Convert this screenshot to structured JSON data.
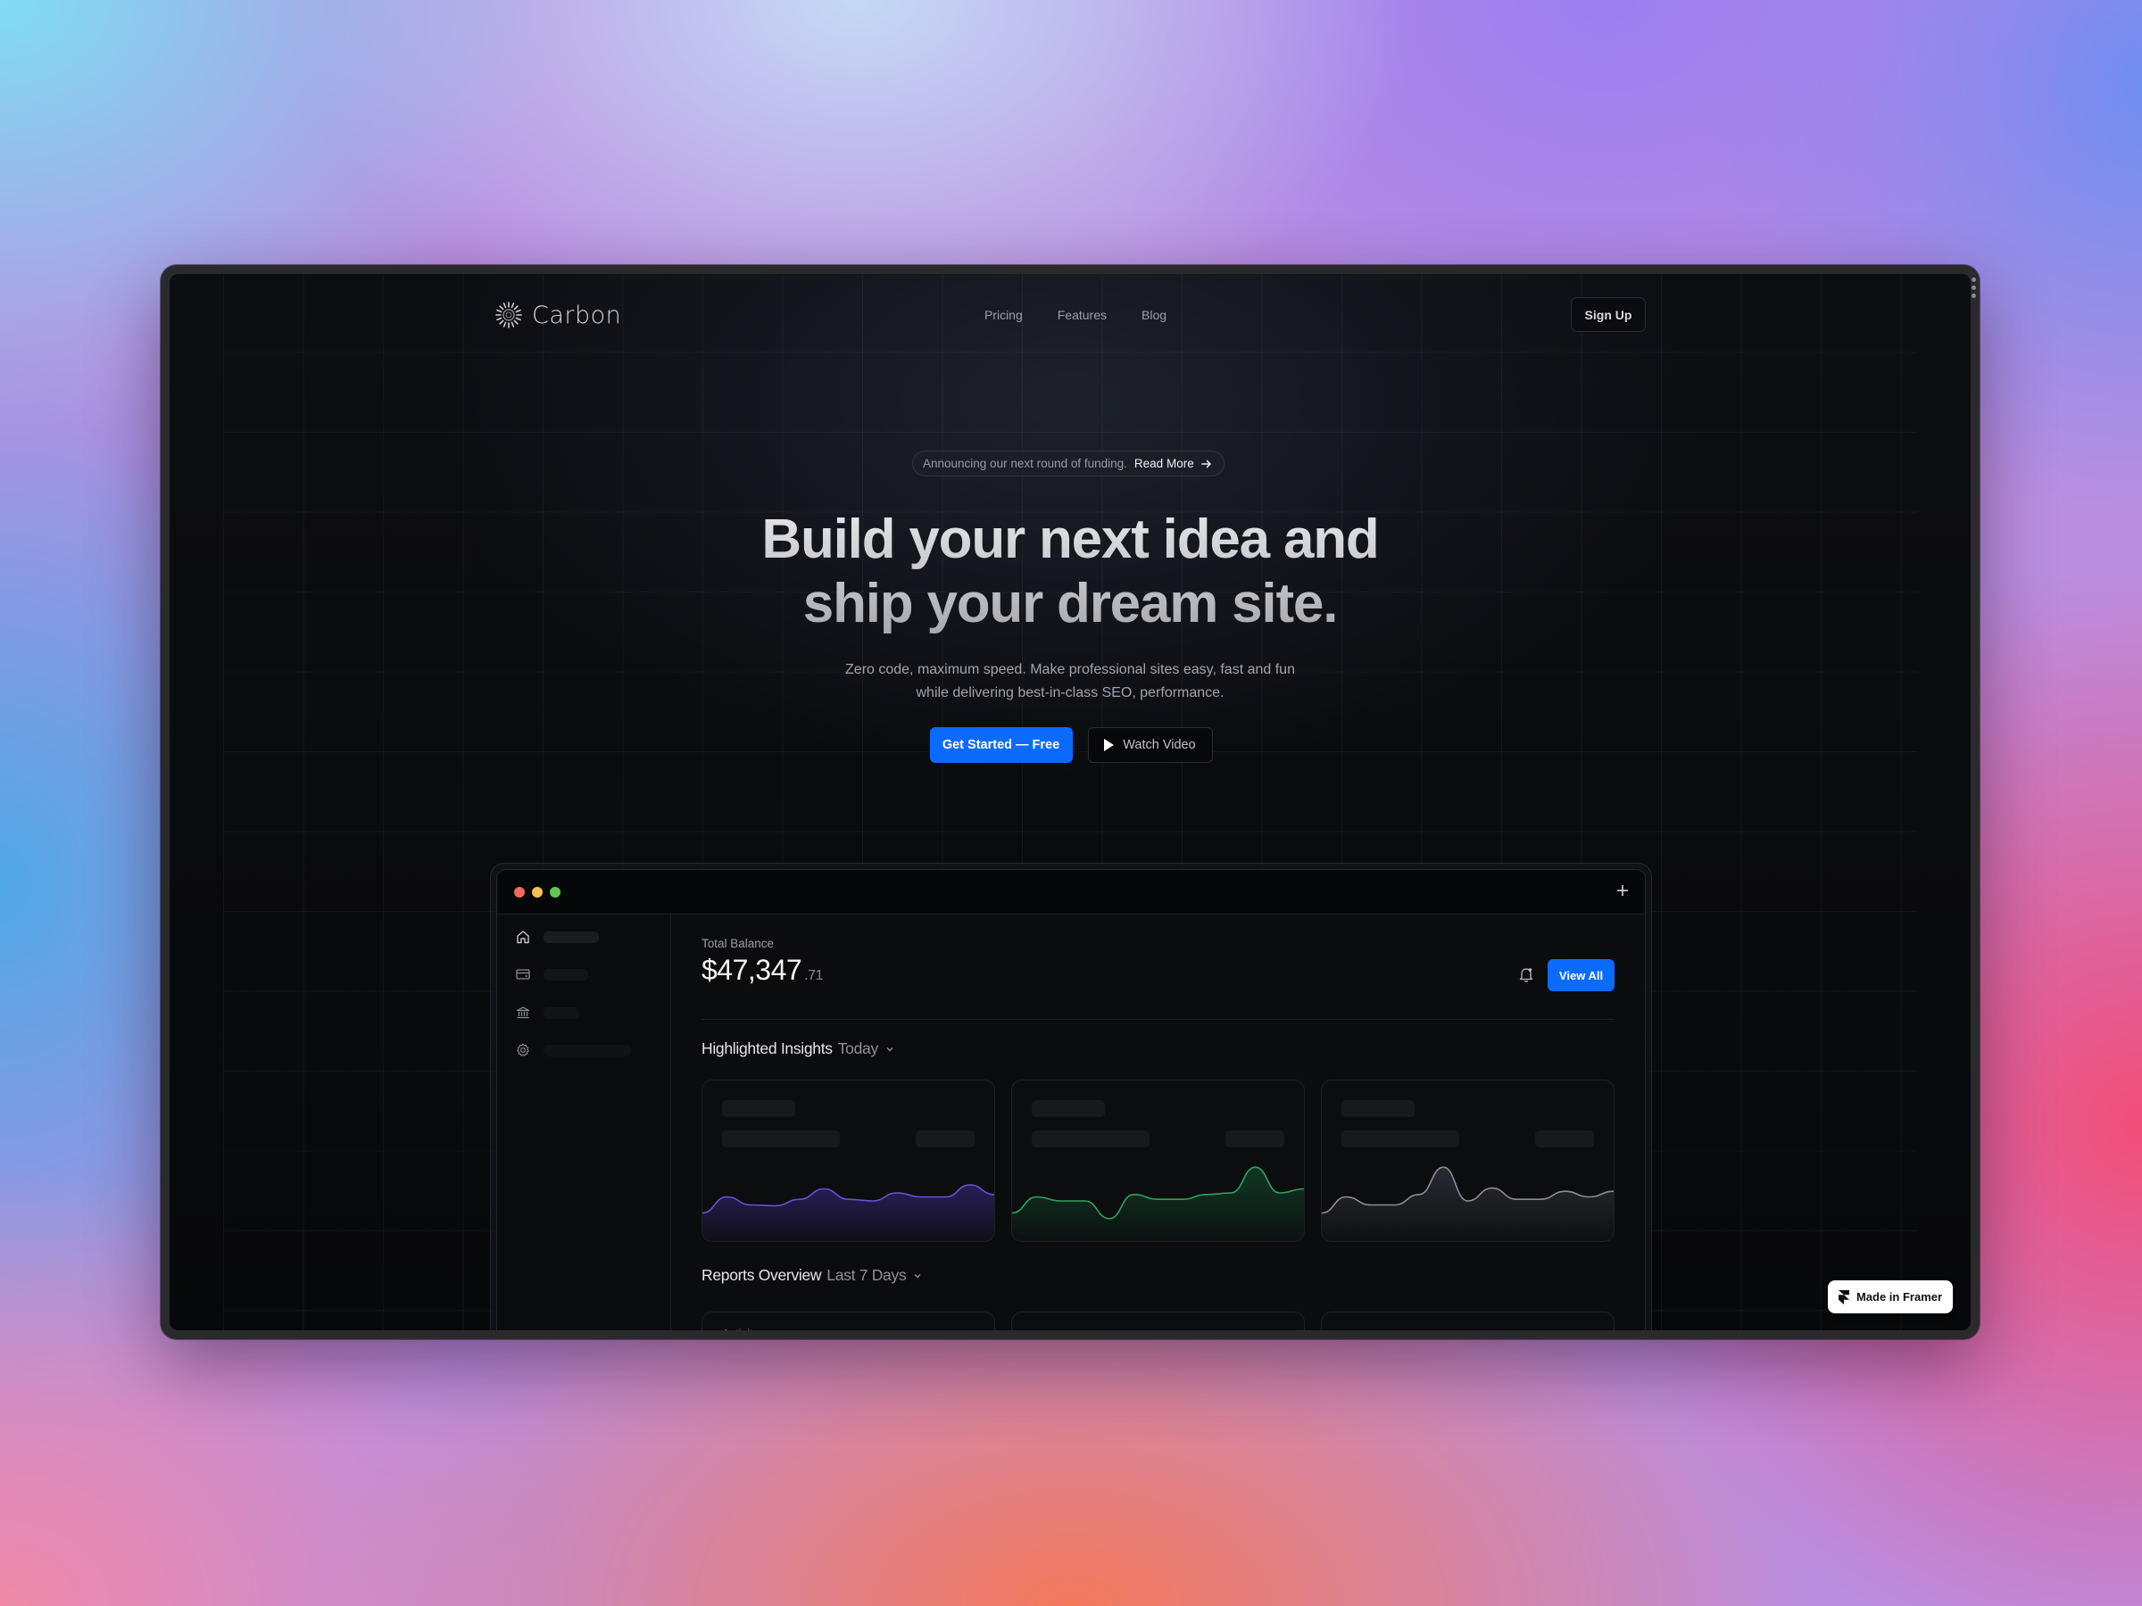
{
  "site": {
    "brand": "Carbon",
    "nav": {
      "links": [
        {
          "label": "Pricing"
        },
        {
          "label": "Features"
        },
        {
          "label": "Blog"
        }
      ],
      "signup_label": "Sign Up"
    },
    "hero": {
      "announcement_text": "Announcing our next round of funding.",
      "announcement_link": "Read More",
      "title_line1": "Build your next idea and",
      "title_line2": "ship your dream site.",
      "subtitle_line1": "Zero code, maximum speed. Make professional sites easy, fast and fun",
      "subtitle_line2": "while delivering best-in-class SEO, performance.",
      "primary_cta": "Get Started — Free",
      "secondary_cta": "Watch Video"
    }
  },
  "dashboard": {
    "window_controls": {
      "close": "#ed6a5e",
      "minimize": "#f4bf4f",
      "maximize": "#61c554"
    },
    "sidebar": {
      "items": [
        {
          "icon": "home-icon"
        },
        {
          "icon": "credit-card-icon"
        },
        {
          "icon": "bank-icon"
        },
        {
          "icon": "gear-icon"
        }
      ]
    },
    "balance": {
      "label": "Total Balance",
      "whole": "$47,347",
      "cents": ".71"
    },
    "view_all_label": "View All",
    "insights": {
      "title": "Highlighted Insights",
      "filter": "Today",
      "cards": [
        {
          "color": "#6a4fd6",
          "fill": "#2a1f5c",
          "values": [
            0.35,
            0.55,
            0.45,
            0.44,
            0.52,
            0.65,
            0.52,
            0.5,
            0.6,
            0.55,
            0.55,
            0.7,
            0.58
          ]
        },
        {
          "color": "#2fa35f",
          "fill": "#0f3a24",
          "values": [
            0.35,
            0.55,
            0.5,
            0.5,
            0.28,
            0.58,
            0.52,
            0.52,
            0.58,
            0.6,
            0.92,
            0.6,
            0.65
          ]
        },
        {
          "color": "#8a8d96",
          "fill": "#2a2c33",
          "values": [
            0.35,
            0.55,
            0.45,
            0.45,
            0.58,
            0.92,
            0.5,
            0.66,
            0.52,
            0.52,
            0.62,
            0.55,
            0.62
          ]
        }
      ]
    },
    "reports": {
      "title": "Reports Overview",
      "filter": "Last 7 Days",
      "cards": [
        {
          "label": "Activity"
        },
        {
          "label": ""
        },
        {
          "label": ""
        }
      ]
    }
  },
  "badge": {
    "label": "Made in Framer"
  }
}
